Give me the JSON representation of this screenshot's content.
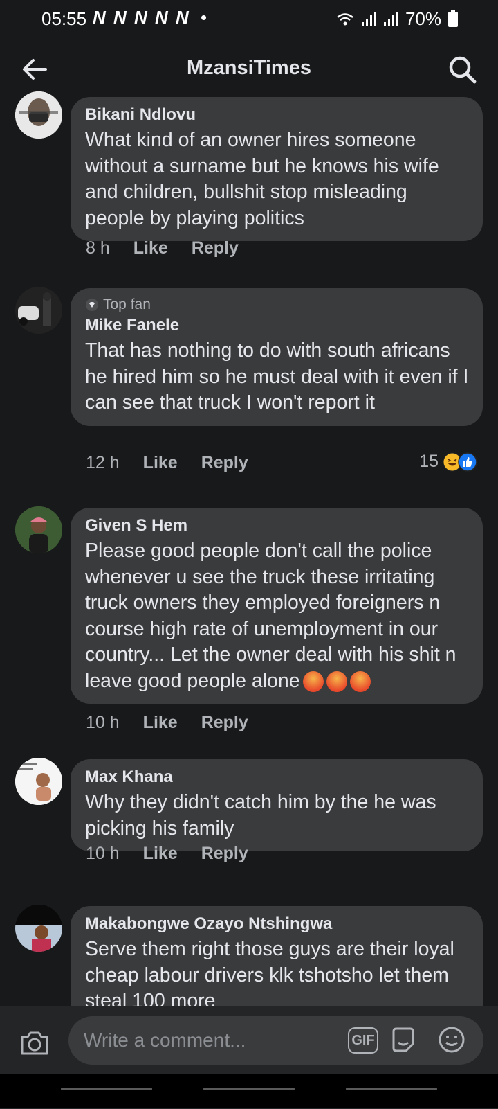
{
  "status_bar": {
    "time": "05:55",
    "notifications": "N N N N N",
    "dot": "•",
    "battery": "70%"
  },
  "app_bar": {
    "title": "MzansiTimes"
  },
  "comments": [
    {
      "author": "Bikani Ndlovu",
      "text": "What kind of an owner hires someone without a surname but he knows his wife and children, bullshit stop misleading people by playing politics",
      "time": "8 h",
      "like": "Like",
      "reply": "Reply"
    },
    {
      "badge": "Top fan",
      "author": "Mike Fanele",
      "text": "That has nothing to do with south africans he hired him so he must deal with it even if I can see that truck I won't report it",
      "time": "12 h",
      "like": "Like",
      "reply": "Reply",
      "reaction_count": "15",
      "reaction_icons": [
        "laugh-reaction-icon",
        "like-reaction-icon"
      ]
    },
    {
      "author": "Given S Hem",
      "text": "Please good people don't call the police whenever u see the truck these irritating truck owners they employed foreigners n course high rate of unemployment in our country... Let the owner deal with his shit n leave good people alone",
      "emoji": [
        "angry-emoji-icon",
        "angry-emoji-icon",
        "angry-emoji-icon"
      ],
      "time": "10 h",
      "like": "Like",
      "reply": "Reply"
    },
    {
      "author": "Max Khana",
      "text": "Why they didn't catch him by the he was picking his family",
      "time": "10 h",
      "like": "Like",
      "reply": "Reply"
    },
    {
      "author": "Makabongwe Ozayo Ntshingwa",
      "text": "Serve them right those guys are their loyal cheap labour drivers klk tshotsho let them steal 100 more"
    }
  ],
  "composer": {
    "placeholder": "Write a comment...",
    "gif_label": "GIF"
  },
  "colors": {
    "background": "#18191a",
    "bubble": "#3a3b3c",
    "text": "#e4e6eb",
    "secondary": "#b0b3b8",
    "like_blue": "#1877f2"
  }
}
